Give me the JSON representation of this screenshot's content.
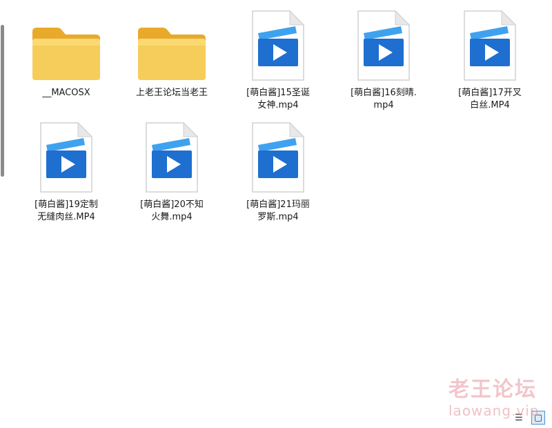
{
  "files": [
    {
      "name": "__MACOSX",
      "type": "folder",
      "icon": "folder-icon"
    },
    {
      "name": "上老王论坛当老王",
      "type": "folder",
      "icon": "folder-icon"
    },
    {
      "name": "[萌白酱]15圣诞女神.mp4",
      "type": "video",
      "icon": "video-file-icon"
    },
    {
      "name": "[萌白酱]16刻晴.mp4",
      "type": "video",
      "icon": "video-file-icon"
    },
    {
      "name": "[萌白酱]17开叉白丝.MP4",
      "type": "video",
      "icon": "video-file-icon"
    },
    {
      "name": "[萌白酱]19定制无缝肉丝.MP4",
      "type": "video",
      "icon": "video-file-icon"
    },
    {
      "name": "[萌白酱]20不知火舞.mp4",
      "type": "video",
      "icon": "video-file-icon"
    },
    {
      "name": "[萌白酱]21玛丽罗斯.mp4",
      "type": "video",
      "icon": "video-file-icon"
    }
  ],
  "statusbar": {
    "list_view_icon": "list-view-icon",
    "tiles_view_icon": "large-icons-view-icon"
  },
  "watermark": {
    "text": "老王论坛",
    "url": "laowang.vip"
  },
  "colors": {
    "folder": "#f5c84a",
    "video_blue": "#1e6fd0",
    "selection": "#4a90d9",
    "watermark": "#e896a0"
  }
}
